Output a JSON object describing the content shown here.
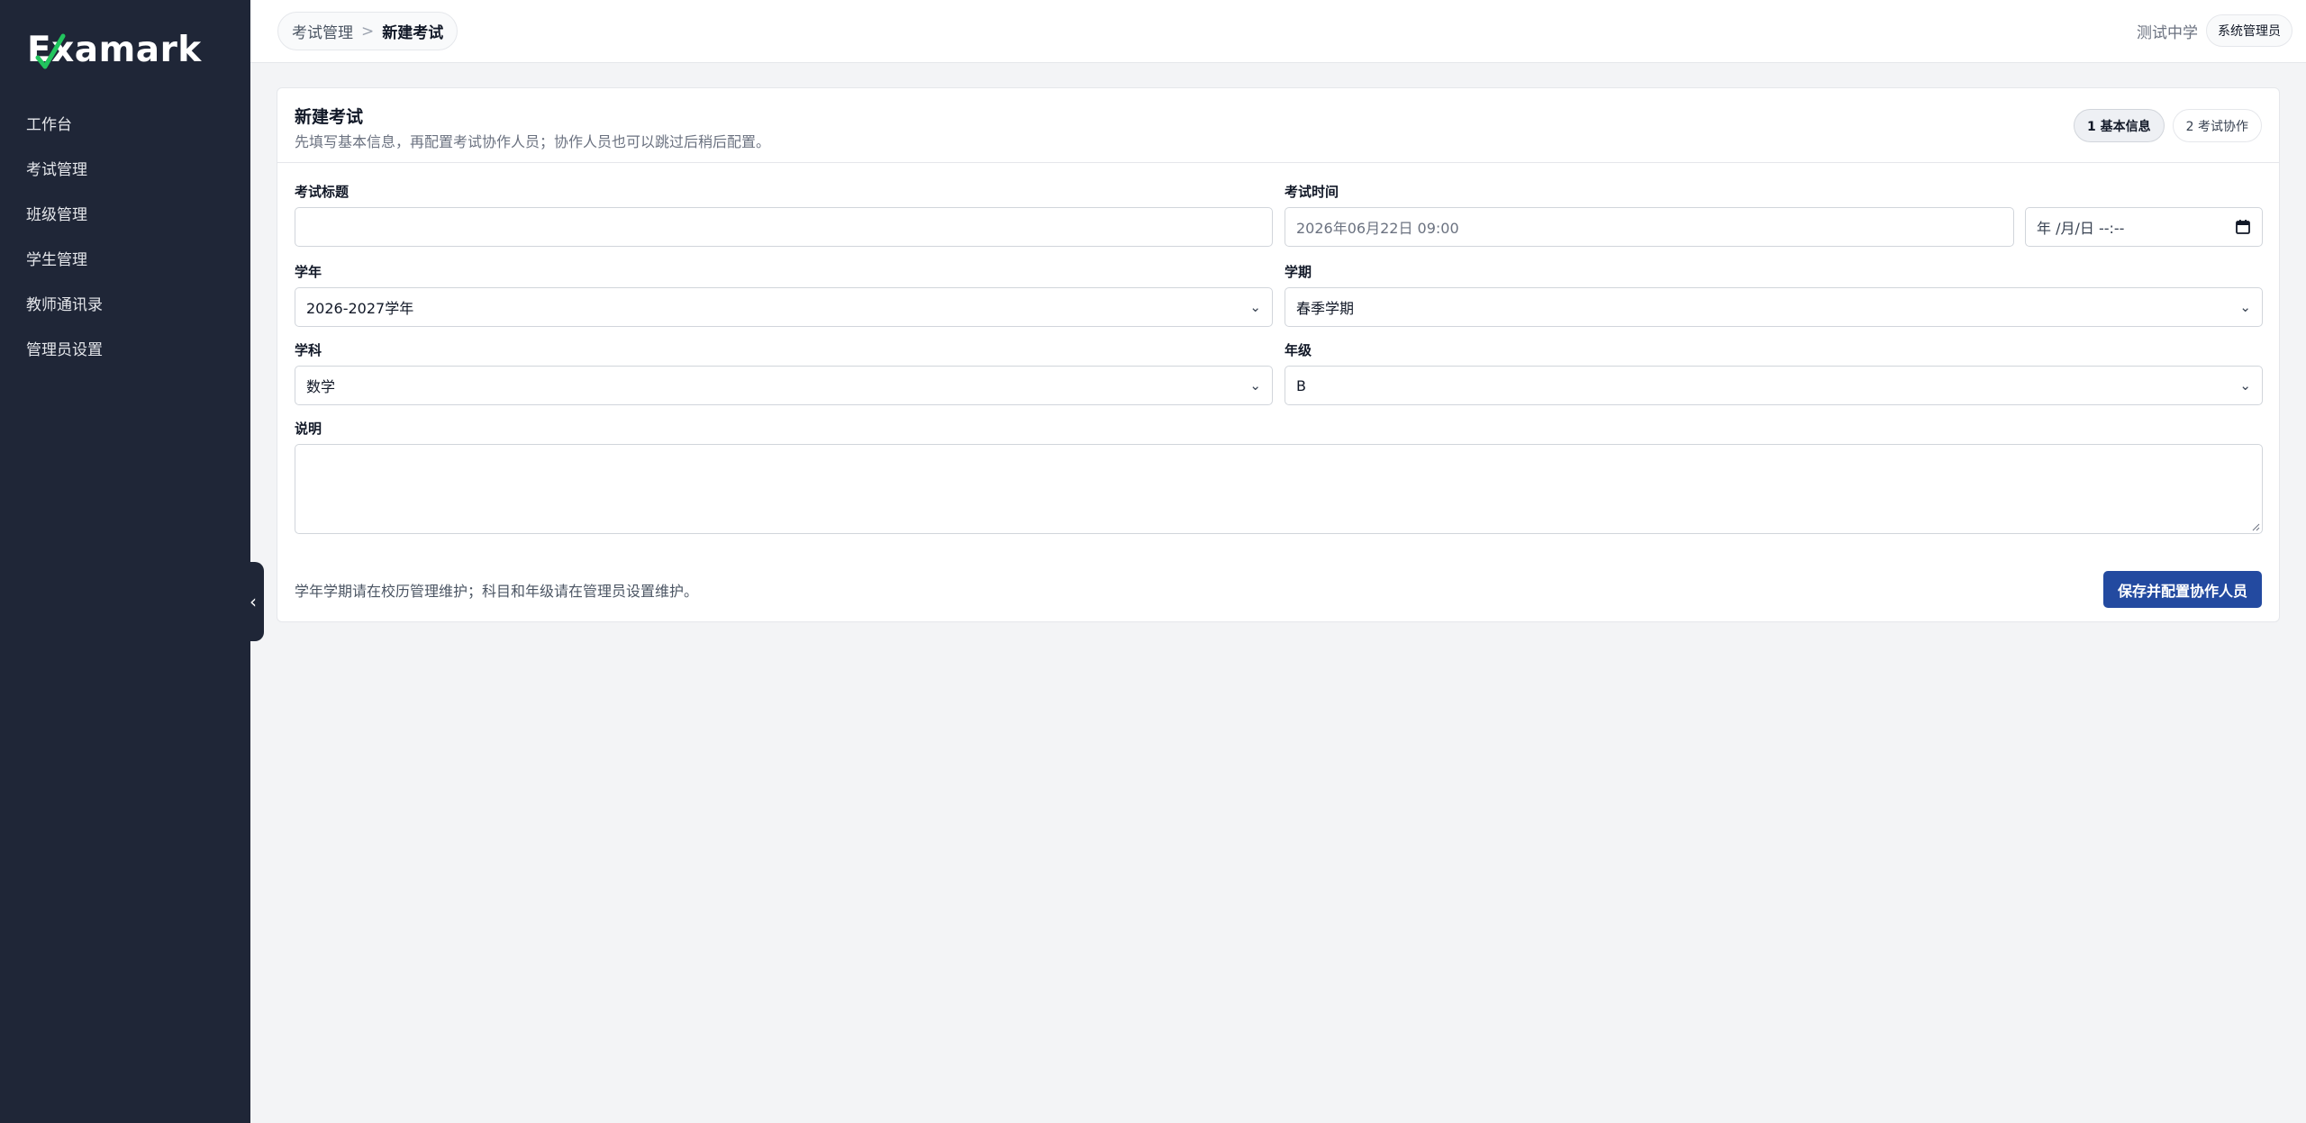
{
  "app": {
    "logo_text": "Examark"
  },
  "sidebar": {
    "items": [
      {
        "label": "工作台"
      },
      {
        "label": "考试管理"
      },
      {
        "label": "班级管理"
      },
      {
        "label": "学生管理"
      },
      {
        "label": "教师通讯录"
      },
      {
        "label": "管理员设置"
      }
    ],
    "collapse_icon": "chevron-left-icon",
    "collapse_glyph": "‹",
    "background": "#1f2637"
  },
  "header": {
    "breadcrumb": {
      "parent": "考试管理",
      "separator": ">",
      "current": "新建考试"
    },
    "school": "测试中学",
    "role": "系统管理员"
  },
  "form": {
    "title": "新建考试",
    "subtitle": "先填写基本信息，再配置考试协作人员；协作人员也可以跳过后稍后配置。",
    "steps": [
      {
        "label": "1 基本信息",
        "active": true
      },
      {
        "label": "2 考试协作",
        "active": false
      }
    ],
    "exam_title": {
      "label": "考试标题",
      "value": ""
    },
    "exam_time": {
      "label": "考试时间",
      "placeholder": "2026年06月22日 09:00",
      "picker_value": "年 /月/日 --:--",
      "picker_icon": "calendar-icon"
    },
    "school_year": {
      "label": "学年",
      "value": "2026-2027学年"
    },
    "semester": {
      "label": "学期",
      "value": "春季学期"
    },
    "subject": {
      "label": "学科",
      "value": "数学"
    },
    "grade": {
      "label": "年级",
      "value": "B"
    },
    "description": {
      "label": "说明",
      "value": ""
    },
    "footer_note": "学年学期请在校历管理维护；科目和年级请在管理员设置维护。",
    "save_label": "保存并配置协作人员",
    "accent_color": "#234aa0"
  }
}
